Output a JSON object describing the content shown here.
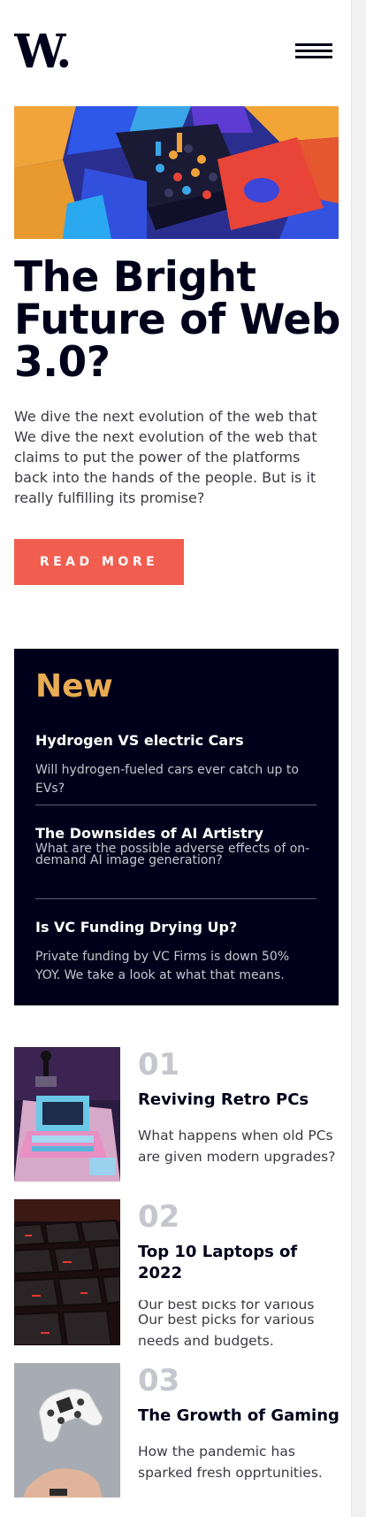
{
  "header": {
    "logo_text": "W.",
    "menu_icon": "hamburger-menu-icon"
  },
  "hero": {
    "title": "The Bright Future of Web 3.0?",
    "description": "We dive the next evolution of the web that We dive the next evolution of the web that claims to put the power of the platforms back into the hands of the people. But is it really fulfilling its promise?",
    "button_label": "READ MORE"
  },
  "new_section": {
    "heading": "New",
    "items": [
      {
        "title": "Hydrogen VS electric Cars",
        "desc": "Will hydrogen-fueled cars ever catch up to EVs?"
      },
      {
        "title": "The Downsides of AI Artistry",
        "desc": "What are the possible adverse effects of on-demand AI image generation?"
      },
      {
        "title": "Is VC Funding Drying Up?",
        "desc": "Private funding by VC Firms is down 50% YOY. We take a look at what that means."
      }
    ]
  },
  "articles": [
    {
      "num": "01",
      "title": "Reviving Retro PCs",
      "desc": "What happens when old PCs are given modern upgrades?"
    },
    {
      "num": "02",
      "title": "Top 10 Laptops of 2022",
      "desc_hidden": "Our best picks for various",
      "desc": "Our best picks for various needs and budgets."
    },
    {
      "num": "03",
      "title": "The Growth of Gaming",
      "desc": "How the pandemic has sparked fresh opprtunities."
    }
  ],
  "colors": {
    "navy": "#00001a",
    "accent": "#f15e50",
    "gold": "#e9ab53",
    "muted": "#c5c6ce"
  }
}
